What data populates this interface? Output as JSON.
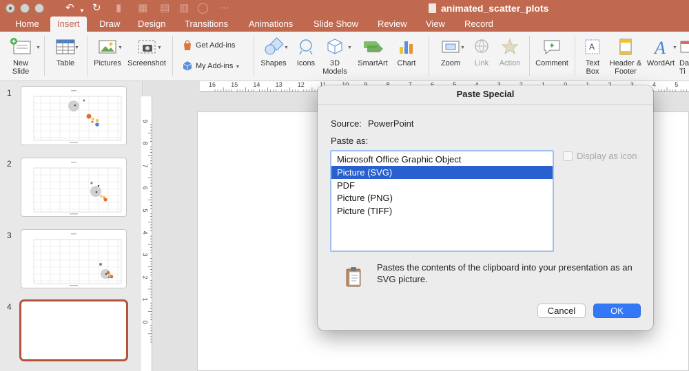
{
  "window": {
    "title": "animated_scatter_plots"
  },
  "tabs": [
    "Home",
    "Insert",
    "Draw",
    "Design",
    "Transitions",
    "Animations",
    "Slide Show",
    "Review",
    "View",
    "Record"
  ],
  "active_tab": "Insert",
  "ribbon": {
    "new_slide": [
      "New",
      "Slide"
    ],
    "table": "Table",
    "pictures": "Pictures",
    "screenshot": "Screenshot",
    "get_addins": "Get Add-ins",
    "my_addins": "My Add-ins",
    "shapes": "Shapes",
    "icons": "Icons",
    "models_3d": [
      "3D",
      "Models"
    ],
    "smartart": "SmartArt",
    "chart": "Chart",
    "zoom": "Zoom",
    "link": "Link",
    "action": "Action",
    "comment": "Comment",
    "text_box": [
      "Text",
      "Box"
    ],
    "header_footer": [
      "Header &",
      "Footer"
    ],
    "wordart": "WordArt",
    "date_time_partial": [
      "Da",
      "Ti"
    ]
  },
  "slides": [
    {
      "number": "1"
    },
    {
      "number": "2"
    },
    {
      "number": "3"
    },
    {
      "number": "4"
    }
  ],
  "ruler": {
    "horizontal_ticks": [
      "16",
      "15",
      "14",
      "13",
      "12",
      "11",
      "10",
      "9",
      "8",
      "7",
      "6",
      "5",
      "4",
      "3",
      "2",
      "1",
      "0",
      "1",
      "2",
      "3",
      "4",
      "5"
    ],
    "vertical_ticks": [
      "9",
      "8",
      "7",
      "6",
      "5",
      "4",
      "3",
      "2",
      "1",
      "0"
    ]
  },
  "dialog": {
    "title": "Paste Special",
    "source_label": "Source:",
    "source_value": "PowerPoint",
    "paste_as_label": "Paste as:",
    "options": [
      "Microsoft Office Graphic Object",
      "Picture (SVG)",
      "PDF",
      "Picture (PNG)",
      "Picture (TIFF)"
    ],
    "selected_option": "Picture (SVG)",
    "display_as_icon": "Display as icon",
    "description": "Pastes the contents of the clipboard into your presentation as an SVG picture.",
    "cancel": "Cancel",
    "ok": "OK"
  },
  "colors": {
    "accent": "#c1694f",
    "selection": "#2860d0",
    "ok_button": "#3478f6"
  }
}
